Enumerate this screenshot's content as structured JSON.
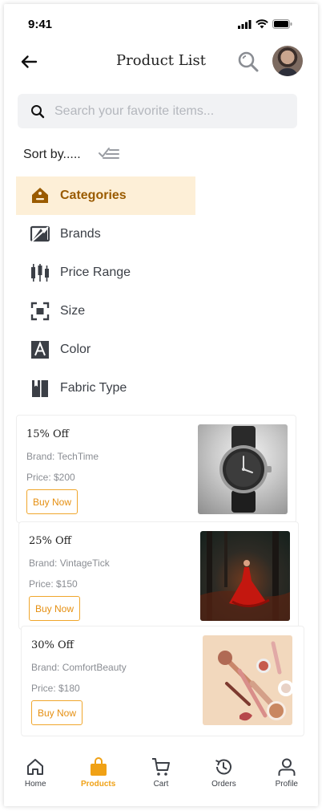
{
  "status_bar": {
    "time": "9:41"
  },
  "header": {
    "title": "Product List",
    "back_icon": "arrow-left-icon",
    "search_icon": "search-icon"
  },
  "search": {
    "placeholder": "Search your favorite items...",
    "value": ""
  },
  "sort": {
    "label": "Sort by.....",
    "icon": "sort-list-icon"
  },
  "filters": [
    {
      "label": "Categories",
      "icon": "tag-icon",
      "active": true
    },
    {
      "label": "Brands",
      "icon": "brand-icon",
      "active": false
    },
    {
      "label": "Price Range",
      "icon": "price-range-icon",
      "active": false
    },
    {
      "label": "Size",
      "icon": "size-icon",
      "active": false
    },
    {
      "label": "Color",
      "icon": "color-icon",
      "active": false
    },
    {
      "label": "Fabric Type",
      "icon": "fabric-icon",
      "active": false
    }
  ],
  "products": [
    {
      "name": "15% Off",
      "brand": "Brand: TechTime",
      "price": "Price: $200",
      "button": "Buy Now",
      "image": "wristwatch"
    },
    {
      "name": "25% Off",
      "brand": "Brand: VintageTick",
      "price": "Price: $150",
      "button": "Buy Now",
      "image": "woman-in-red-dress"
    },
    {
      "name": "30% Off",
      "brand": "Brand: ComfortBeauty",
      "price": "Price: $180",
      "button": "Buy Now",
      "image": "makeup-products"
    }
  ],
  "nav": [
    {
      "label": "Home",
      "icon": "home-icon",
      "active": false
    },
    {
      "label": "Products",
      "icon": "shopping-bag-icon",
      "active": true
    },
    {
      "label": "Cart",
      "icon": "cart-icon",
      "active": false
    },
    {
      "label": "Orders",
      "icon": "history-icon",
      "active": false
    },
    {
      "label": "Profile",
      "icon": "profile-icon",
      "active": false
    }
  ],
  "colors": {
    "accent": "#f0a115",
    "active_bg": "#fdefd7",
    "active_text": "#9a5b00",
    "icon": "#3b3f46"
  }
}
